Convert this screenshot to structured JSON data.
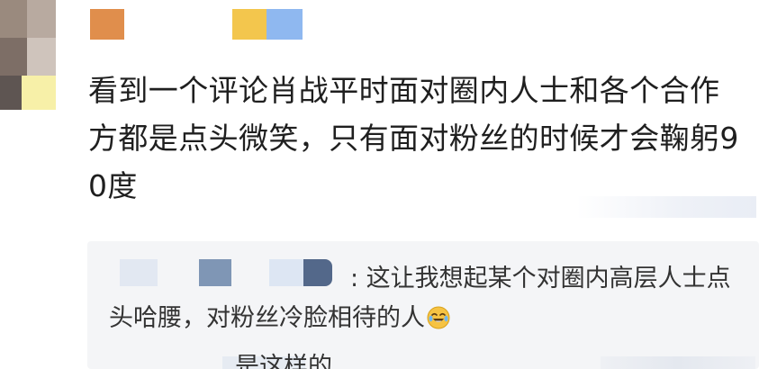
{
  "comment": {
    "text": "看到一个评论肖战平时面对圈内人士和各个合作方都是点头微笑，只有面对粉丝的时候才会鞠躬90度"
  },
  "reply": {
    "text": ": 这让我想起某个对圈内高层人士点头哈腰，对粉丝冷脸相待的人",
    "emoji_icon": "laughing-tears-emoji-icon"
  },
  "sub_reply": {
    "text": "是这样的"
  },
  "colors": {
    "reply_background": "#f4f5f7",
    "body_text": "#1f1f1f",
    "reply_text": "#333333"
  }
}
